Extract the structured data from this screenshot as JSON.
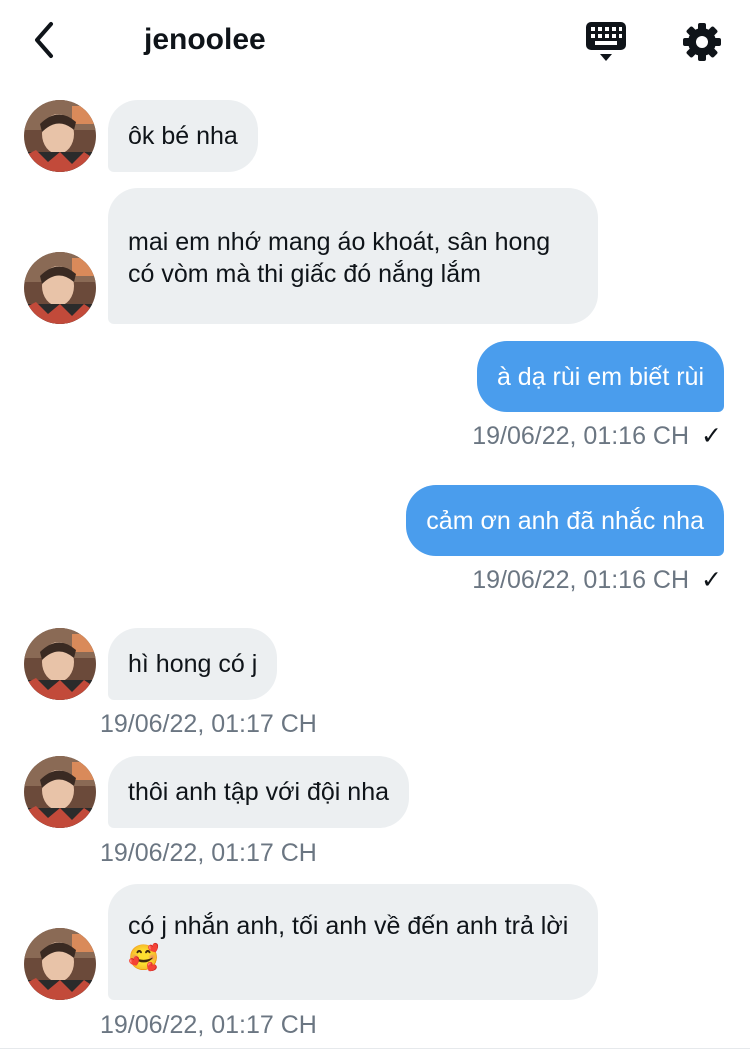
{
  "header": {
    "title": "jenoolee",
    "back_icon": "chevron-left-icon",
    "keyboard_icon": "keyboard-icon",
    "settings_icon": "gear-icon"
  },
  "colors": {
    "outgoing_bubble": "#4a9ded",
    "incoming_bubble": "#eceff1",
    "timestamp": "#6b7682"
  },
  "messages": [
    {
      "direction": "in",
      "text": "ôk bé nha"
    },
    {
      "direction": "in",
      "text": "mai em nhớ mang áo khoát, sân hong có vòm mà thi giấc đó nắng lắm"
    },
    {
      "direction": "out",
      "text": "à dạ rùi em biết rùi",
      "time": "19/06/22, 01:16 CH",
      "status": "✓"
    },
    {
      "direction": "out",
      "text": "cảm ơn anh đã nhắc nha",
      "time": "19/06/22, 01:16 CH",
      "status": "✓"
    },
    {
      "direction": "in",
      "text": "hì hong có j",
      "time": "19/06/22, 01:17 CH"
    },
    {
      "direction": "in",
      "text": "thôi anh tập với đội nha",
      "time": "19/06/22, 01:17 CH"
    },
    {
      "direction": "in",
      "text": "có j nhắn anh, tối anh về đến anh trả lời 🥰",
      "time": "19/06/22, 01:17 CH"
    }
  ]
}
